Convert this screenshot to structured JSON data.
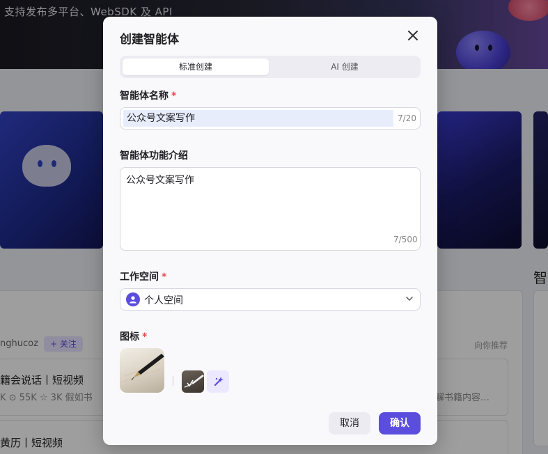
{
  "background": {
    "banner_text": "支持发布多平台、WebSDK 及 API",
    "user_name": "nghucoz",
    "follow_label": "+ 关注",
    "recommend_label": "向你推荐",
    "item1_title": "籍会说话丨短视频",
    "item1_stats": "K  ⊙ 55K  ☆ 3K   假如书",
    "item1_desc": "解书籍内容…",
    "item2_title": "黄历丨短视频",
    "side_heading": "智"
  },
  "modal": {
    "title": "创建智能体",
    "close_icon": "close-icon",
    "tabs": [
      {
        "label": "标准创建",
        "active": true
      },
      {
        "label": "AI 创建",
        "active": false
      }
    ],
    "name_label": "智能体名称",
    "name_required": "*",
    "name_value": "公众号文案写作",
    "name_counter": "7/20",
    "desc_label": "智能体功能介绍",
    "desc_value": "公众号文案写作",
    "desc_counter": "7/500",
    "workspace_label": "工作空间",
    "workspace_required": "*",
    "workspace_value": "个人空间",
    "icon_label": "图标",
    "icon_required": "*",
    "cancel_label": "取消",
    "confirm_label": "确认"
  },
  "colors": {
    "accent": "#5b4ddd",
    "required": "#e5484d"
  }
}
